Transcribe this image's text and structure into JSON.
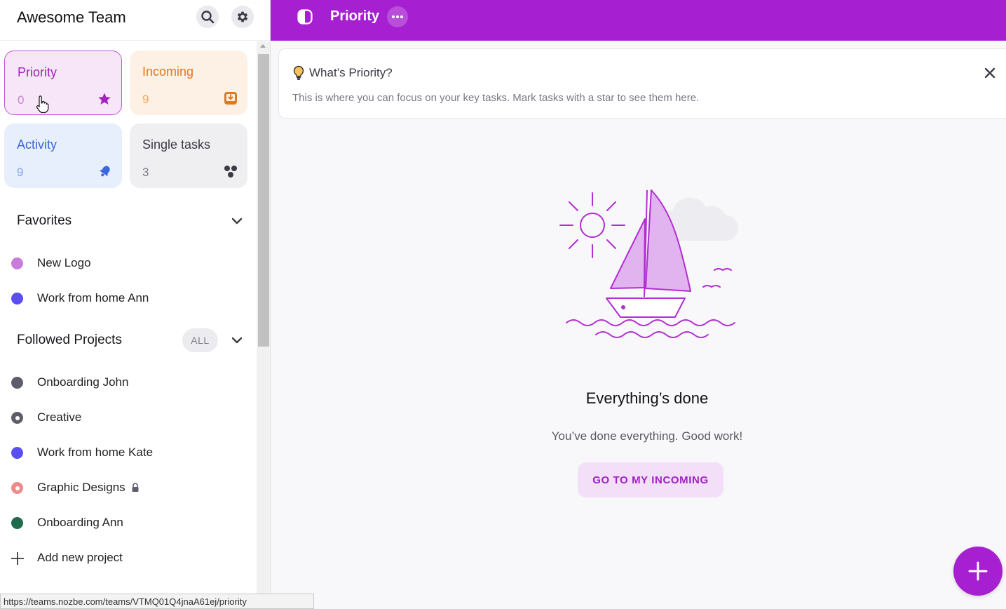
{
  "sidebar": {
    "team_name": "Awesome Team",
    "cards": {
      "priority": {
        "label": "Priority",
        "count": "0"
      },
      "incoming": {
        "label": "Incoming",
        "count": "9"
      },
      "activity": {
        "label": "Activity",
        "count": "9"
      },
      "single_tasks": {
        "label": "Single tasks",
        "count": "3"
      }
    },
    "favorites": {
      "title": "Favorites",
      "items": [
        {
          "label": "New Logo",
          "color": "#c77dd9"
        },
        {
          "label": "Work from home Ann",
          "color": "#5b4ef0"
        }
      ]
    },
    "followed": {
      "title": "Followed Projects",
      "all_label": "ALL",
      "items": [
        {
          "label": "Onboarding John",
          "color": "#5c5f6b"
        },
        {
          "label": "Creative",
          "color": "#5c5f6b"
        },
        {
          "label": "Work from home Kate",
          "color": "#5b4ef0"
        },
        {
          "label": "Graphic Designs",
          "color": "#f08a8a"
        },
        {
          "label": "Onboarding Ann",
          "color": "#1e6b4e"
        }
      ],
      "add_label": "Add new project"
    }
  },
  "topbar": {
    "title": "Priority"
  },
  "banner": {
    "title": "What’s Priority?",
    "text": "This is where you can focus on your key tasks. Mark tasks with a star to see them here."
  },
  "empty_state": {
    "title": "Everything’s done",
    "subtitle": "You’ve done everything. Good work!",
    "cta_label": "GO TO MY INCOMING"
  },
  "status_bar": {
    "url": "https://teams.nozbe.com/teams/VTMQ01Q4jnaA61ej/priority"
  },
  "colors": {
    "accent": "#a61fd1",
    "priority": "#a621c2",
    "incoming": "#e07a1a",
    "activity": "#3a67dd"
  }
}
